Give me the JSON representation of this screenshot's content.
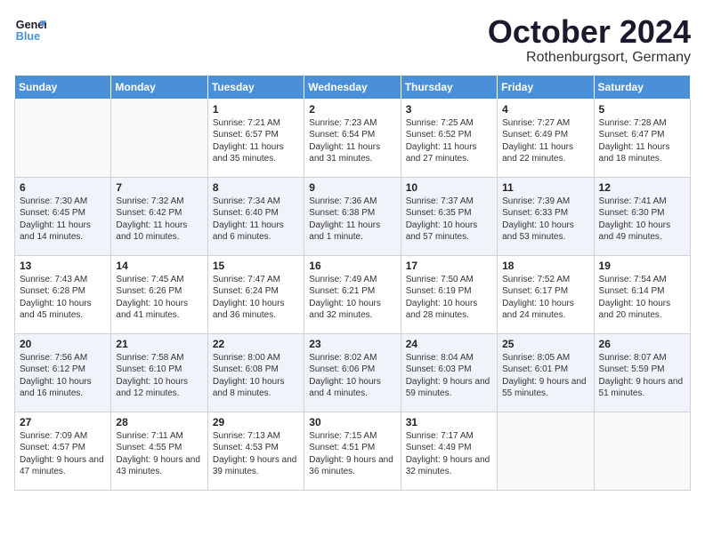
{
  "header": {
    "logo_line1": "General",
    "logo_line2": "Blue",
    "month": "October 2024",
    "location": "Rothenburgsort, Germany"
  },
  "weekdays": [
    "Sunday",
    "Monday",
    "Tuesday",
    "Wednesday",
    "Thursday",
    "Friday",
    "Saturday"
  ],
  "weeks": [
    [
      {
        "day": "",
        "content": ""
      },
      {
        "day": "",
        "content": ""
      },
      {
        "day": "1",
        "content": "Sunrise: 7:21 AM\nSunset: 6:57 PM\nDaylight: 11 hours\nand 35 minutes."
      },
      {
        "day": "2",
        "content": "Sunrise: 7:23 AM\nSunset: 6:54 PM\nDaylight: 11 hours\nand 31 minutes."
      },
      {
        "day": "3",
        "content": "Sunrise: 7:25 AM\nSunset: 6:52 PM\nDaylight: 11 hours\nand 27 minutes."
      },
      {
        "day": "4",
        "content": "Sunrise: 7:27 AM\nSunset: 6:49 PM\nDaylight: 11 hours\nand 22 minutes."
      },
      {
        "day": "5",
        "content": "Sunrise: 7:28 AM\nSunset: 6:47 PM\nDaylight: 11 hours\nand 18 minutes."
      }
    ],
    [
      {
        "day": "6",
        "content": "Sunrise: 7:30 AM\nSunset: 6:45 PM\nDaylight: 11 hours\nand 14 minutes."
      },
      {
        "day": "7",
        "content": "Sunrise: 7:32 AM\nSunset: 6:42 PM\nDaylight: 11 hours\nand 10 minutes."
      },
      {
        "day": "8",
        "content": "Sunrise: 7:34 AM\nSunset: 6:40 PM\nDaylight: 11 hours\nand 6 minutes."
      },
      {
        "day": "9",
        "content": "Sunrise: 7:36 AM\nSunset: 6:38 PM\nDaylight: 11 hours\nand 1 minute."
      },
      {
        "day": "10",
        "content": "Sunrise: 7:37 AM\nSunset: 6:35 PM\nDaylight: 10 hours\nand 57 minutes."
      },
      {
        "day": "11",
        "content": "Sunrise: 7:39 AM\nSunset: 6:33 PM\nDaylight: 10 hours\nand 53 minutes."
      },
      {
        "day": "12",
        "content": "Sunrise: 7:41 AM\nSunset: 6:30 PM\nDaylight: 10 hours\nand 49 minutes."
      }
    ],
    [
      {
        "day": "13",
        "content": "Sunrise: 7:43 AM\nSunset: 6:28 PM\nDaylight: 10 hours\nand 45 minutes."
      },
      {
        "day": "14",
        "content": "Sunrise: 7:45 AM\nSunset: 6:26 PM\nDaylight: 10 hours\nand 41 minutes."
      },
      {
        "day": "15",
        "content": "Sunrise: 7:47 AM\nSunset: 6:24 PM\nDaylight: 10 hours\nand 36 minutes."
      },
      {
        "day": "16",
        "content": "Sunrise: 7:49 AM\nSunset: 6:21 PM\nDaylight: 10 hours\nand 32 minutes."
      },
      {
        "day": "17",
        "content": "Sunrise: 7:50 AM\nSunset: 6:19 PM\nDaylight: 10 hours\nand 28 minutes."
      },
      {
        "day": "18",
        "content": "Sunrise: 7:52 AM\nSunset: 6:17 PM\nDaylight: 10 hours\nand 24 minutes."
      },
      {
        "day": "19",
        "content": "Sunrise: 7:54 AM\nSunset: 6:14 PM\nDaylight: 10 hours\nand 20 minutes."
      }
    ],
    [
      {
        "day": "20",
        "content": "Sunrise: 7:56 AM\nSunset: 6:12 PM\nDaylight: 10 hours\nand 16 minutes."
      },
      {
        "day": "21",
        "content": "Sunrise: 7:58 AM\nSunset: 6:10 PM\nDaylight: 10 hours\nand 12 minutes."
      },
      {
        "day": "22",
        "content": "Sunrise: 8:00 AM\nSunset: 6:08 PM\nDaylight: 10 hours\nand 8 minutes."
      },
      {
        "day": "23",
        "content": "Sunrise: 8:02 AM\nSunset: 6:06 PM\nDaylight: 10 hours\nand 4 minutes."
      },
      {
        "day": "24",
        "content": "Sunrise: 8:04 AM\nSunset: 6:03 PM\nDaylight: 9 hours\nand 59 minutes."
      },
      {
        "day": "25",
        "content": "Sunrise: 8:05 AM\nSunset: 6:01 PM\nDaylight: 9 hours\nand 55 minutes."
      },
      {
        "day": "26",
        "content": "Sunrise: 8:07 AM\nSunset: 5:59 PM\nDaylight: 9 hours\nand 51 minutes."
      }
    ],
    [
      {
        "day": "27",
        "content": "Sunrise: 7:09 AM\nSunset: 4:57 PM\nDaylight: 9 hours\nand 47 minutes."
      },
      {
        "day": "28",
        "content": "Sunrise: 7:11 AM\nSunset: 4:55 PM\nDaylight: 9 hours\nand 43 minutes."
      },
      {
        "day": "29",
        "content": "Sunrise: 7:13 AM\nSunset: 4:53 PM\nDaylight: 9 hours\nand 39 minutes."
      },
      {
        "day": "30",
        "content": "Sunrise: 7:15 AM\nSunset: 4:51 PM\nDaylight: 9 hours\nand 36 minutes."
      },
      {
        "day": "31",
        "content": "Sunrise: 7:17 AM\nSunset: 4:49 PM\nDaylight: 9 hours\nand 32 minutes."
      },
      {
        "day": "",
        "content": ""
      },
      {
        "day": "",
        "content": ""
      }
    ]
  ]
}
